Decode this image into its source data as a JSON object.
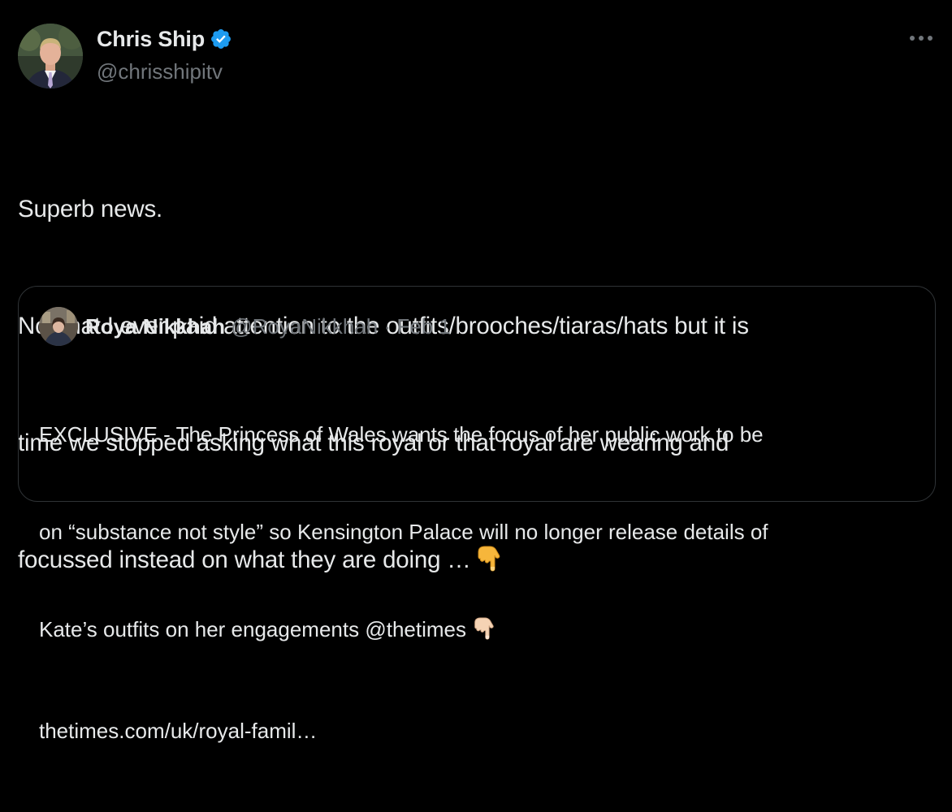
{
  "tweet": {
    "author": {
      "name": "Chris Ship",
      "handle": "@chrisshipitv",
      "verified": true
    },
    "text_lines": [
      "Superb news.",
      "Not that I ever paid attention to the outfits/brooches/tiaras/hats but it is",
      "time we stopped asking what this royal or that royal are wearing and",
      "focussed instead on what they are doing …"
    ],
    "emoji": "backhand-index-pointing-down-icon"
  },
  "quoted_tweet": {
    "author": {
      "name": "Roya Nikkhah",
      "handle": "@RoyaNikkhah",
      "separator": "·",
      "date": "Feb 1"
    },
    "text_lines": [
      "EXCLUSIVE - The Princess of Wales wants the focus of her public work to be",
      "on “substance not style” so Kensington Palace will no longer release details of",
      "Kate’s outfits on her engagements @thetimes"
    ],
    "link": "thetimes.com/uk/royal-famil…",
    "emoji": "backhand-index-pointing-down-icon"
  },
  "colors": {
    "background": "#000000",
    "text_primary": "#e7e9ea",
    "text_secondary": "#71767b",
    "border": "#2f3336",
    "verified_blue": "#1d9bf0"
  }
}
